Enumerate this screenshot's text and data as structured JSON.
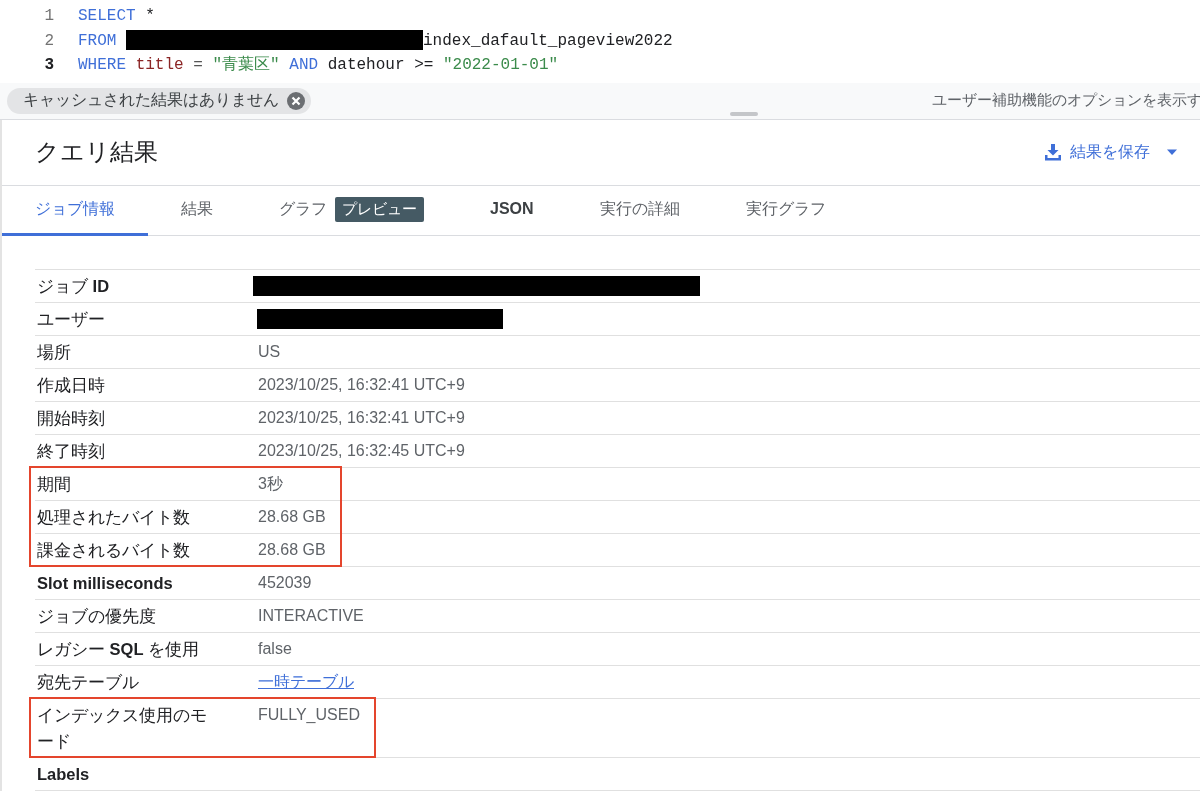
{
  "editor": {
    "lines": [
      {
        "number": "1",
        "active": false,
        "tokens": [
          {
            "kind": "keyword",
            "text": "SELECT"
          },
          {
            "kind": "plain",
            "text": "*"
          }
        ]
      },
      {
        "number": "2",
        "active": false,
        "tokens": [
          {
            "kind": "keyword",
            "text": "FROM"
          },
          {
            "kind": "redacted"
          },
          {
            "kind": "plain",
            "text": "index_dafault_pageview2022"
          }
        ]
      },
      {
        "number": "3",
        "active": true,
        "tokens": [
          {
            "kind": "keyword",
            "text": "WHERE"
          },
          {
            "kind": "ident",
            "text": "title"
          },
          {
            "kind": "op",
            "text": "="
          },
          {
            "kind": "string",
            "text": "\"青葉区\""
          },
          {
            "kind": "keyword",
            "text": "AND"
          },
          {
            "kind": "plain",
            "text": "datehour"
          },
          {
            "kind": "plain",
            "text": ">="
          },
          {
            "kind": "string",
            "text": "\"2022-01-01\""
          }
        ]
      }
    ]
  },
  "cache_chip": {
    "label": "キャッシュされた結果はありません"
  },
  "accessibility_hint": "ユーザー補助機能のオプションを表示す",
  "results": {
    "title": "クエリ結果",
    "save_button": "結果を保存",
    "tabs": [
      {
        "label": "ジョブ情報",
        "selected": true
      },
      {
        "label": "結果",
        "selected": false
      },
      {
        "label": "グラフ",
        "selected": false,
        "badge": "プレビュー"
      },
      {
        "label": "JSON",
        "selected": false,
        "bold": true
      },
      {
        "label": "実行の詳細",
        "selected": false
      },
      {
        "label": "実行グラフ",
        "selected": false
      }
    ],
    "rows": [
      {
        "label": "ジョブ **ID**",
        "kind": "redacted",
        "highlighted": false
      },
      {
        "label": "ユーザー",
        "kind": "redacted",
        "highlighted": false
      },
      {
        "label": "場所",
        "value": "US",
        "kind": "text",
        "highlighted": false
      },
      {
        "label": "作成日時",
        "value": "2023/10/25, 16:32:41 UTC+9",
        "kind": "text",
        "highlighted": false
      },
      {
        "label": "開始時刻",
        "value": "2023/10/25, 16:32:41 UTC+9",
        "kind": "text",
        "highlighted": false
      },
      {
        "label": "終了時刻",
        "value": "2023/10/25, 16:32:45 UTC+9",
        "kind": "text",
        "highlighted": false
      },
      {
        "label": "期間",
        "value": "3秒",
        "kind": "text",
        "highlighted": true
      },
      {
        "label": "処理されたバイト数",
        "value": "28.68 GB",
        "kind": "text",
        "highlighted": true
      },
      {
        "label": "課金されるバイト数",
        "value": "28.68 GB",
        "kind": "text",
        "highlighted": true
      },
      {
        "label": "Slot milliseconds",
        "bold": true,
        "value": "452039",
        "kind": "text",
        "highlighted": false
      },
      {
        "label": "ジョブの優先度",
        "value": "INTERACTIVE",
        "kind": "text",
        "highlighted": false
      },
      {
        "label": "レガシー **SQL** を使用",
        "value": "false",
        "kind": "text",
        "highlighted": false
      },
      {
        "label": "宛先テーブル",
        "value": "一時テーブル",
        "kind": "link",
        "highlighted": false
      },
      {
        "label": "インデックス使用のモード",
        "value": "FULLY_USED",
        "kind": "text",
        "highlighted": true
      },
      {
        "label": "Labels",
        "bold": true,
        "kind": "text",
        "highlighted": false
      }
    ]
  }
}
